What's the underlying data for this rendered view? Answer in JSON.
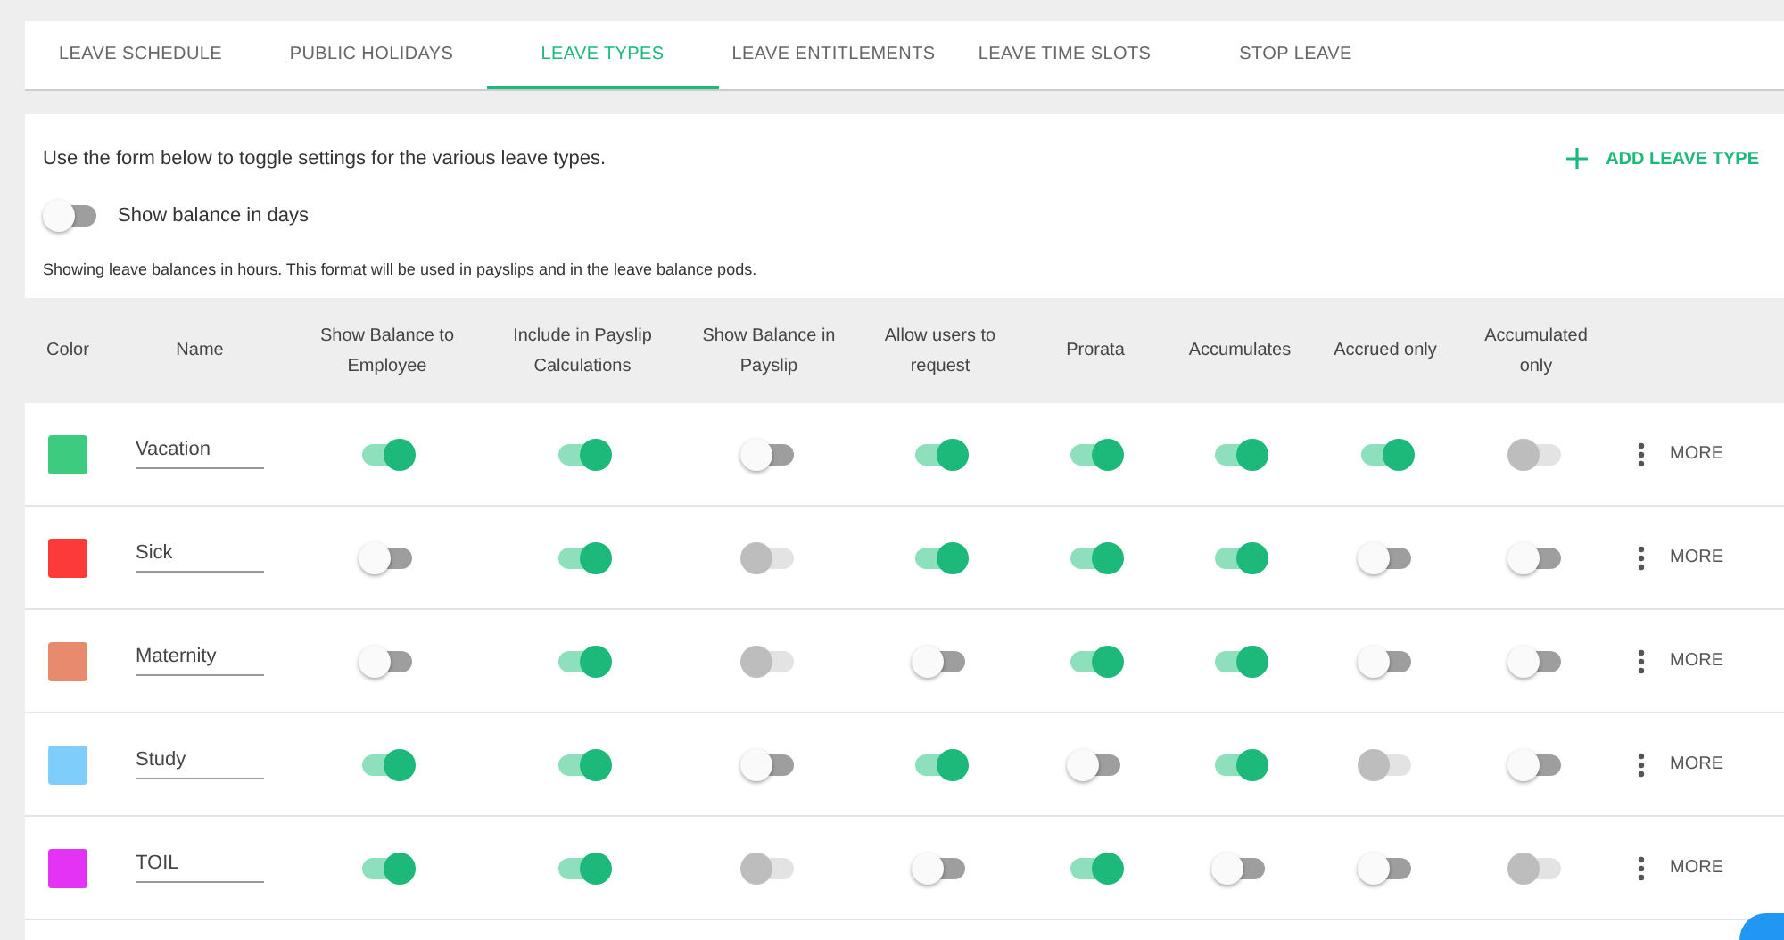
{
  "tabs": [
    {
      "label": "LEAVE SCHEDULE",
      "selected": false
    },
    {
      "label": "PUBLIC HOLIDAYS",
      "selected": false
    },
    {
      "label": "LEAVE TYPES",
      "selected": true
    },
    {
      "label": "LEAVE ENTITLEMENTS",
      "selected": false
    },
    {
      "label": "LEAVE TIME SLOTS",
      "selected": false
    },
    {
      "label": "STOP LEAVE",
      "selected": false
    }
  ],
  "intro": "Use the form below to toggle settings for the various leave types.",
  "add_button": {
    "label": "ADD LEAVE TYPE"
  },
  "days_toggle": {
    "label": "Show balance in days",
    "on": false
  },
  "note": "Showing leave balances in hours. This format will be used in payslips and in the leave balance pods.",
  "table": {
    "columns": [
      "Color",
      "Name",
      "Show Balance to Employee",
      "Include in Payslip Calculations",
      "Show Balance in Payslip",
      "Allow users to request",
      "Prorata",
      "Accumulates",
      "Accrued only",
      "Accumulated only"
    ],
    "rows": [
      {
        "color": "#3ccb7f",
        "name": "Vacation",
        "more": "MORE",
        "toggles": [
          {
            "on": true,
            "disabled": false
          },
          {
            "on": true,
            "disabled": false
          },
          {
            "on": false,
            "disabled": false
          },
          {
            "on": true,
            "disabled": false
          },
          {
            "on": true,
            "disabled": false
          },
          {
            "on": true,
            "disabled": false
          },
          {
            "on": true,
            "disabled": false
          },
          {
            "on": false,
            "disabled": true
          }
        ]
      },
      {
        "color": "#fc3a3a",
        "name": "Sick",
        "more": "MORE",
        "toggles": [
          {
            "on": false,
            "disabled": false
          },
          {
            "on": true,
            "disabled": false
          },
          {
            "on": false,
            "disabled": true
          },
          {
            "on": true,
            "disabled": false
          },
          {
            "on": true,
            "disabled": false
          },
          {
            "on": true,
            "disabled": false
          },
          {
            "on": false,
            "disabled": false
          },
          {
            "on": false,
            "disabled": false
          }
        ]
      },
      {
        "color": "#e88a6e",
        "name": "Maternity",
        "more": "MORE",
        "toggles": [
          {
            "on": false,
            "disabled": false
          },
          {
            "on": true,
            "disabled": false
          },
          {
            "on": false,
            "disabled": true
          },
          {
            "on": false,
            "disabled": false
          },
          {
            "on": true,
            "disabled": false
          },
          {
            "on": true,
            "disabled": false
          },
          {
            "on": false,
            "disabled": false
          },
          {
            "on": false,
            "disabled": false
          }
        ]
      },
      {
        "color": "#7fcdfb",
        "name": "Study",
        "more": "MORE",
        "toggles": [
          {
            "on": true,
            "disabled": false
          },
          {
            "on": true,
            "disabled": false
          },
          {
            "on": false,
            "disabled": false
          },
          {
            "on": true,
            "disabled": false
          },
          {
            "on": false,
            "disabled": false
          },
          {
            "on": true,
            "disabled": false
          },
          {
            "on": false,
            "disabled": true
          },
          {
            "on": false,
            "disabled": false
          }
        ]
      },
      {
        "color": "#e433f5",
        "name": "TOIL",
        "more": "MORE",
        "toggles": [
          {
            "on": true,
            "disabled": false
          },
          {
            "on": true,
            "disabled": false
          },
          {
            "on": false,
            "disabled": true
          },
          {
            "on": false,
            "disabled": false
          },
          {
            "on": true,
            "disabled": false
          },
          {
            "on": false,
            "disabled": false
          },
          {
            "on": false,
            "disabled": false
          },
          {
            "on": false,
            "disabled": true
          }
        ]
      }
    ]
  }
}
